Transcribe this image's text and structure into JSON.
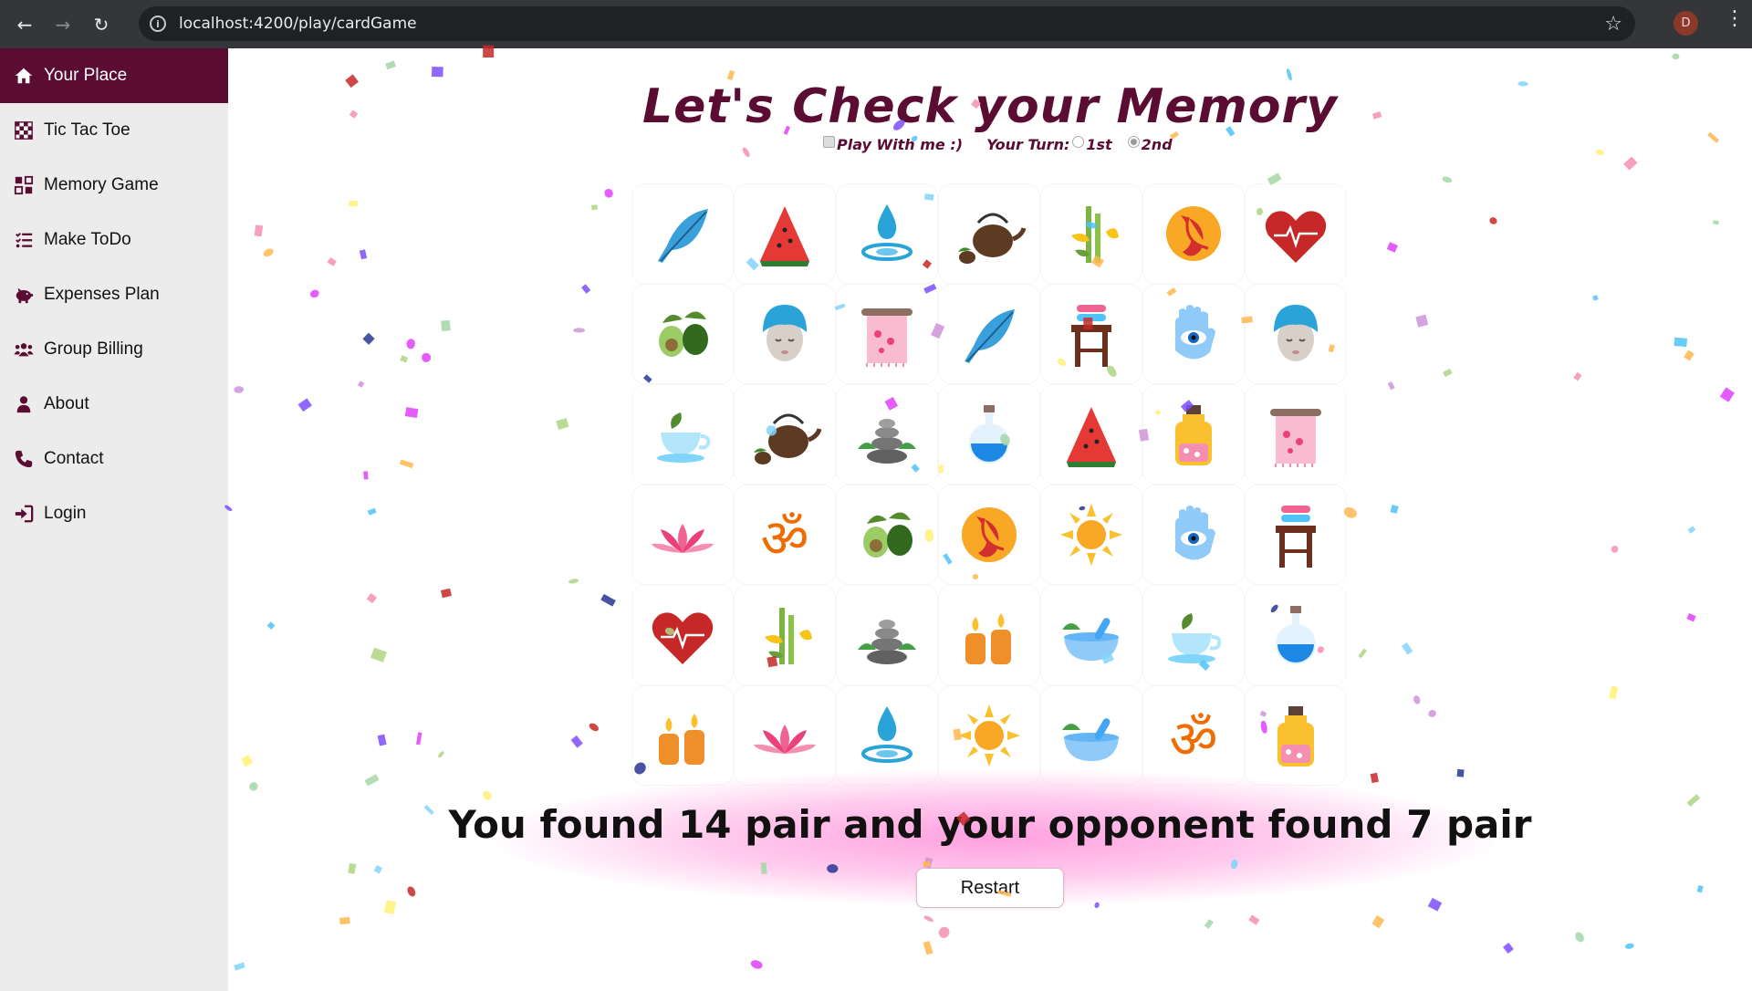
{
  "browser": {
    "url": "localhost:4200/play/cardGame",
    "profile_initial": "D"
  },
  "sidebar": {
    "items": [
      {
        "label": "Your Place",
        "icon": "home-icon",
        "active": true
      },
      {
        "label": "Tic Tac Toe",
        "icon": "checkerboard-icon"
      },
      {
        "label": "Memory Game",
        "icon": "grid-icon"
      },
      {
        "label": "Make ToDo",
        "icon": "list-icon"
      },
      {
        "label": "Expenses Plan",
        "icon": "piggy-bank-icon"
      },
      {
        "label": "Group Billing",
        "icon": "users-icon"
      },
      {
        "label": "About",
        "icon": "user-icon"
      },
      {
        "label": "Contact",
        "icon": "phone-icon"
      },
      {
        "label": "Login",
        "icon": "login-icon"
      }
    ]
  },
  "game": {
    "title": "Let's Check your Memory",
    "play_with_me_label": "Play With me :)",
    "play_with_me_checked": true,
    "your_turn_label": "Your Turn:",
    "turn_options": [
      "1st",
      "2nd"
    ],
    "selected_turn": "2nd",
    "board": [
      [
        "feather",
        "watermelon",
        "water-drop",
        "teapot",
        "bamboo",
        "koi-fish",
        "heart"
      ],
      [
        "avocado",
        "face-mask",
        "towel",
        "feather",
        "stool",
        "hamsa-eye",
        "face-mask"
      ],
      [
        "tea-cup",
        "teapot",
        "stones",
        "potion",
        "watermelon",
        "oil-bottle",
        "towel"
      ],
      [
        "lotus",
        "om",
        "avocado",
        "koi-fish",
        "sun",
        "hamsa-eye",
        "stool"
      ],
      [
        "heart",
        "bamboo",
        "stones",
        "candles",
        "mortar",
        "tea-cup",
        "potion"
      ],
      [
        "candles",
        "lotus",
        "water-drop",
        "sun",
        "mortar",
        "om",
        "oil-bottle"
      ]
    ],
    "result_text": "You found 14 pair and your opponent found 7 pair",
    "restart_label": "Restart"
  }
}
